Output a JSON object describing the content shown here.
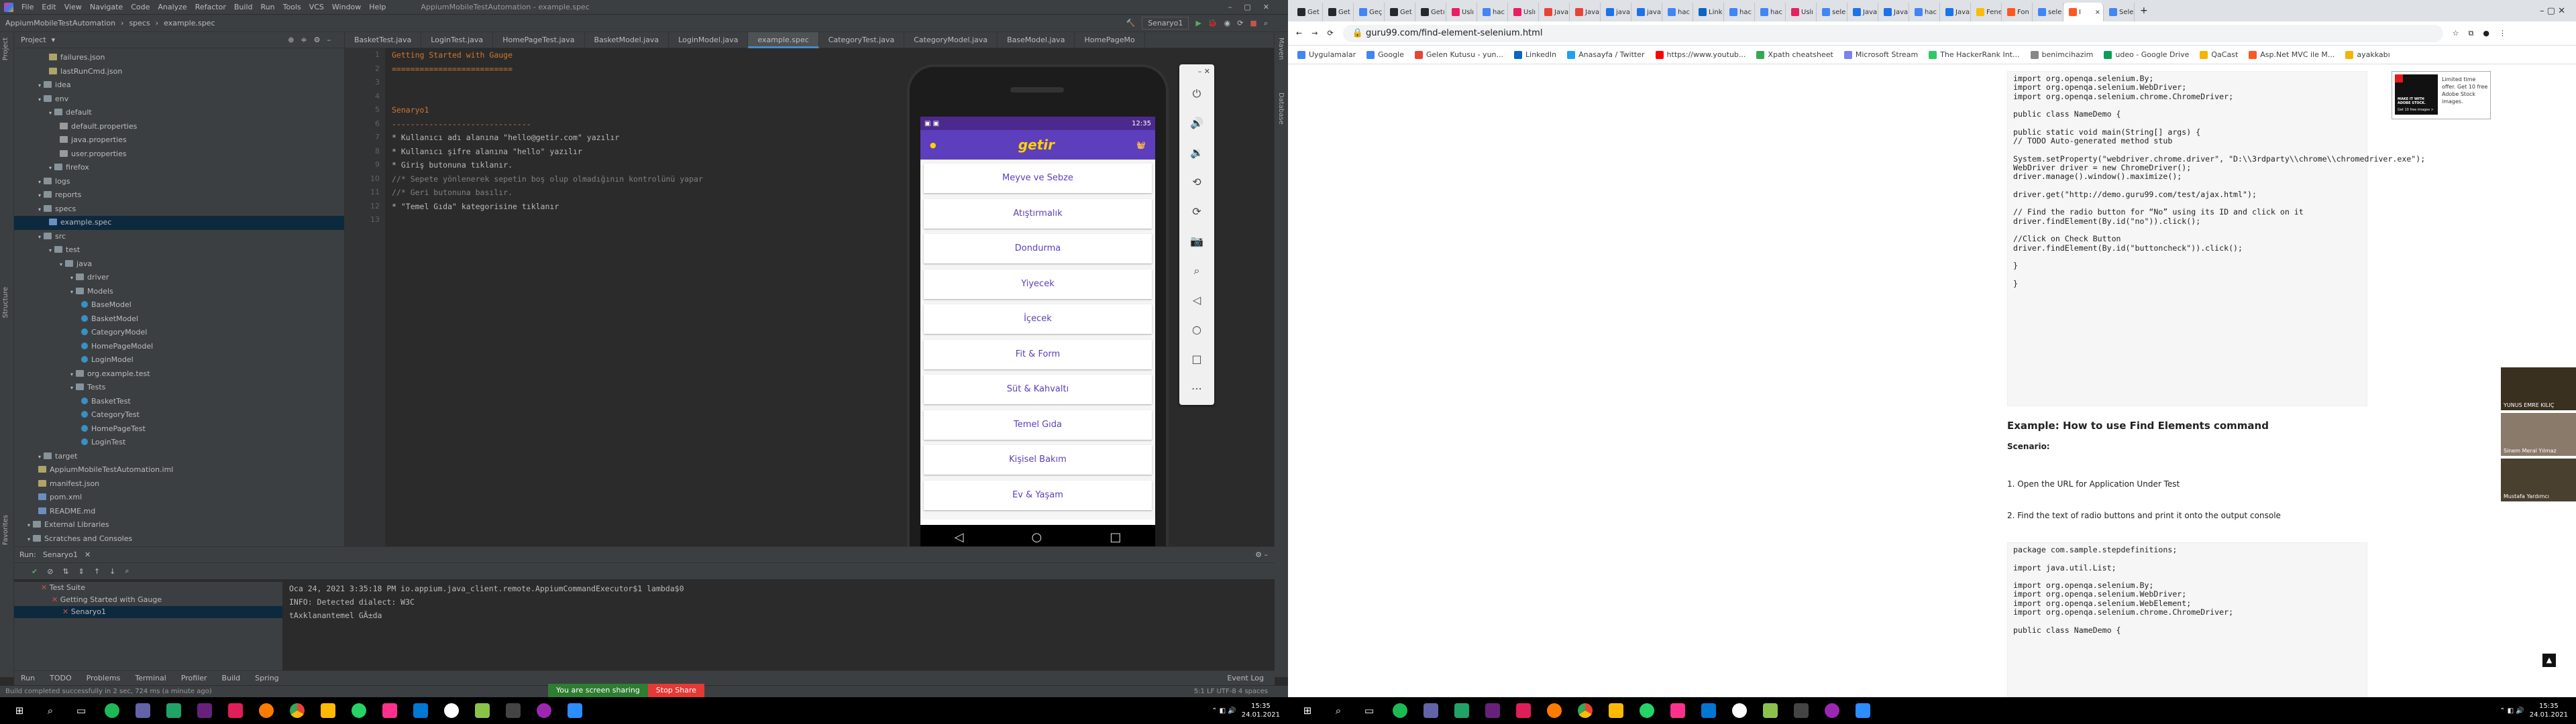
{
  "ide": {
    "menu": [
      "File",
      "Edit",
      "View",
      "Navigate",
      "Code",
      "Analyze",
      "Refactor",
      "Build",
      "Run",
      "Tools",
      "VCS",
      "Window",
      "Help"
    ],
    "window_title": "AppiumMobileTestAutomation - example.spec",
    "breadcrumb": [
      "AppiumMobileTestAutomation",
      "specs",
      "example.spec"
    ],
    "run_config": "Senaryo1",
    "project_header": "Project",
    "tree": [
      {
        "label": "failures.json",
        "depth": 3,
        "type": "json"
      },
      {
        "label": "lastRunCmd.json",
        "depth": 3,
        "type": "json"
      },
      {
        "label": "idea",
        "depth": 2,
        "type": "folder"
      },
      {
        "label": "env",
        "depth": 2,
        "type": "folder"
      },
      {
        "label": "default",
        "depth": 3,
        "type": "folder"
      },
      {
        "label": "default.properties",
        "depth": 4,
        "type": "prop"
      },
      {
        "label": "java.properties",
        "depth": 4,
        "type": "prop"
      },
      {
        "label": "user.properties",
        "depth": 4,
        "type": "prop"
      },
      {
        "label": "firefox",
        "depth": 3,
        "type": "folder"
      },
      {
        "label": "logs",
        "depth": 2,
        "type": "folder"
      },
      {
        "label": "reports",
        "depth": 2,
        "type": "folder"
      },
      {
        "label": "specs",
        "depth": 2,
        "type": "folder"
      },
      {
        "label": "example.spec",
        "depth": 3,
        "type": "spec",
        "selected": true
      },
      {
        "label": "src",
        "depth": 2,
        "type": "folder"
      },
      {
        "label": "test",
        "depth": 3,
        "type": "folder"
      },
      {
        "label": "java",
        "depth": 4,
        "type": "folder"
      },
      {
        "label": "driver",
        "depth": 5,
        "type": "folder"
      },
      {
        "label": "Models",
        "depth": 5,
        "type": "folder"
      },
      {
        "label": "BaseModel",
        "depth": 6,
        "type": "class"
      },
      {
        "label": "BasketModel",
        "depth": 6,
        "type": "class"
      },
      {
        "label": "CategoryModel",
        "depth": 6,
        "type": "class"
      },
      {
        "label": "HomePageModel",
        "depth": 6,
        "type": "class"
      },
      {
        "label": "LoginModel",
        "depth": 6,
        "type": "class"
      },
      {
        "label": "org.example.test",
        "depth": 5,
        "type": "folder"
      },
      {
        "label": "Tests",
        "depth": 5,
        "type": "folder"
      },
      {
        "label": "BasketTest",
        "depth": 6,
        "type": "class"
      },
      {
        "label": "CategoryTest",
        "depth": 6,
        "type": "class"
      },
      {
        "label": "HomePageTest",
        "depth": 6,
        "type": "class"
      },
      {
        "label": "LoginTest",
        "depth": 6,
        "type": "class"
      },
      {
        "label": "target",
        "depth": 2,
        "type": "folder"
      },
      {
        "label": "AppiumMobileTestAutomation.iml",
        "depth": 2,
        "type": "json"
      },
      {
        "label": "manifest.json",
        "depth": 2,
        "type": "json"
      },
      {
        "label": "pom.xml",
        "depth": 2,
        "type": "md"
      },
      {
        "label": "README.md",
        "depth": 2,
        "type": "md"
      },
      {
        "label": "External Libraries",
        "depth": 1,
        "type": "folder"
      },
      {
        "label": "Scratches and Consoles",
        "depth": 1,
        "type": "folder"
      }
    ],
    "tabs": [
      "BasketTest.java",
      "LoginTest.java",
      "HomePageTest.java",
      "BasketModel.java",
      "LoginModel.java",
      "example.spec",
      "CategoryTest.java",
      "CategoryModel.java",
      "BaseModel.java",
      "HomePageMo"
    ],
    "active_tab": 5,
    "line_numbers": [
      "1",
      "2",
      "3",
      "4",
      "5",
      "6",
      "7",
      "8",
      "9",
      "10",
      "11",
      "12",
      "13"
    ],
    "code_lines": [
      {
        "text": "Getting Started with Gauge",
        "cls": "c-head"
      },
      {
        "text": "==========================",
        "cls": "c-rule"
      },
      {
        "text": "",
        "cls": ""
      },
      {
        "text": "",
        "cls": ""
      },
      {
        "text": "Senaryo1",
        "cls": "c-head"
      },
      {
        "text": "------------------------------",
        "cls": "c-rule"
      },
      {
        "text": "* Kullanıcı adı alanına \"hello@getir.com\" yazılır",
        "cls": ""
      },
      {
        "text": "* Kullanıcı şifre alanına \"hello\" yazılır",
        "cls": ""
      },
      {
        "text": "* Giriş butonuna tıklanır.",
        "cls": ""
      },
      {
        "text": "//* Sepete yönlenerek sepetin boş olup olmadığının kontrolünü yapar",
        "cls": "c-cmt"
      },
      {
        "text": "//* Geri butonuna basılır.",
        "cls": "c-cmt"
      },
      {
        "text": "* \"Temel Gıda\" kategorisine tıklanır",
        "cls": ""
      },
      {
        "text": "",
        "cls": ""
      }
    ],
    "run": {
      "header": "Run:",
      "config": "Senaryo1",
      "tree": [
        "Test Suite",
        "Getting Started with Gauge",
        "Senaryo1"
      ],
      "console": [
        "Oca 24, 2021 3:35:18 PM io.appium.java_client.remote.AppiumCommandExecutor$1 lambda$0",
        "INFO: Detected dialect: W3C",
        "tAxklanantemel GÄ±da"
      ]
    },
    "bottom_tabs": [
      "Run",
      "TODO",
      "Problems",
      "Terminal",
      "Profiler",
      "Build",
      "Spring"
    ],
    "event_log": "Event Log",
    "status": "Build completed successfully in 2 sec, 724 ms (a minute ago)",
    "status_right": "5:1  LF  UTF-8  4 spaces",
    "share_text": "You are screen sharing",
    "stop_share": "Stop Share",
    "side_left": [
      "Project",
      "Structure",
      "Favorites"
    ],
    "side_right": [
      "Maven",
      "Database"
    ]
  },
  "phone": {
    "status_time": "12:35",
    "brand": "getir",
    "categories": [
      "Meyve ve Sebze",
      "Atıştırmalık",
      "Dondurma",
      "Yiyecek",
      "İçecek",
      "Fit & Form",
      "Süt & Kahvaltı",
      "Temel Gıda",
      "Kişisel Bakım",
      "Ev & Yaşam"
    ]
  },
  "taskbar": {
    "time": "15:35",
    "date": "24.01.2021"
  },
  "browser": {
    "tabs": [
      "Get",
      "Get",
      "Geç",
      "Get",
      "Getı",
      "Uslı",
      "hac",
      "Uslı",
      "Java",
      "Java",
      "java",
      "java",
      "hac",
      "Link",
      "hac",
      "hac",
      "Uslı",
      "sele",
      "Java",
      "Java",
      "hac",
      "Java",
      "Fenerb",
      "Fon",
      "sele",
      "I",
      "Sele"
    ],
    "active_tab": 25,
    "url": "guru99.com/find-element-selenium.html",
    "bookmarks": [
      "Uygulamalar",
      "Google",
      "Gelen Kutusu - yun...",
      "LinkedIn",
      "Anasayfa / Twitter",
      "https://www.youtub...",
      "Xpath cheatsheet",
      "Microsoft Stream",
      "The HackerRank Int...",
      "benimcihazim",
      "udeo - Google Drive",
      "QaCast",
      "Asp.Net MVC ile M...",
      "ayakkabı"
    ],
    "code1": [
      "import org.openqa.selenium.By;",
      "import org.openqa.selenium.WebDriver;",
      "import org.openqa.selenium.chrome.ChromeDriver;",
      "",
      "public class NameDemo {",
      "",
      "public static void main(String[] args) {",
      "// TODO Auto-generated method stub",
      "",
      "System.setProperty(\"webdriver.chrome.driver\", \"D:\\\\3rdparty\\\\chrome\\\\chromedriver.exe\");",
      "WebDriver driver = new ChromeDriver();",
      "driver.manage().window().maximize();",
      "",
      "driver.get(\"http://demo.guru99.com/test/ajax.html\");",
      "",
      "// Find the radio button for “No” using its ID and click on it",
      "driver.findElement(By.id(\"no\")).click();",
      "",
      "//Click on Check Button",
      "driver.findElement(By.id(\"buttoncheck\")).click();",
      "",
      "}",
      "",
      "}"
    ],
    "heading": "Example: How to use Find Elements command",
    "scenario": "Scenario:",
    "steps": [
      "1. Open the URL for Application Under Test",
      "2. Find the text of radio buttons and print it onto the output console"
    ],
    "code2": [
      "package com.sample.stepdefinitions;",
      "",
      "import java.util.List;",
      "",
      "import org.openqa.selenium.By;",
      "import org.openqa.selenium.WebDriver;",
      "import org.openqa.selenium.WebElement;",
      "import org.openqa.selenium.chrome.ChromeDriver;",
      "",
      "public class NameDemo {"
    ],
    "ad_text": "Limited time offer. Get 10 free Adobe Stock images.",
    "ad_image_text": "MAKE IT WITH ADOBE STOCK.",
    "ad_cta": "Get 10 free images >",
    "videos": [
      "YUNUS EMRE KILIÇ",
      "Sinem Meral Yılmaz",
      "Mustafa Yardımcı"
    ],
    "scroll_top": "▲"
  },
  "colors": {
    "ide_bg": "#2b2b2b",
    "getir_purple": "#5d3ebc",
    "getir_yellow": "#ffd300",
    "share_green": "#2e7d32",
    "share_red": "#e53935"
  }
}
